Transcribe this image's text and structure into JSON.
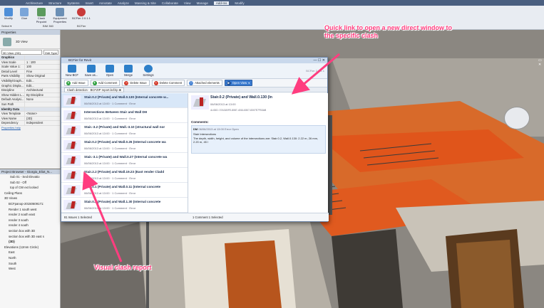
{
  "ribbon": {
    "tabs": [
      "Architecture",
      "Structure",
      "Systems",
      "Insert",
      "Annotate",
      "Analyze",
      "Massing & Site",
      "Collaborate",
      "View",
      "Manage",
      "Add-Ins",
      "Modify"
    ],
    "active_tab": "Add-Ins",
    "buttons": [
      {
        "label": "Modify"
      },
      {
        "label": "Glue"
      },
      {
        "label": "Clash Pinpoint"
      },
      {
        "label": "Equipment Properties"
      },
      {
        "label": "BCFier 2.0.1.1"
      }
    ],
    "groups": [
      "Select ▾",
      "BIM 360",
      "BCFier"
    ]
  },
  "properties": {
    "title": "Properties",
    "type_label": "3D View",
    "view_selector": "3D View: {3D}",
    "edit_type": "Edit Type",
    "rows": [
      {
        "k": "Graphics",
        "v": "",
        "section": true
      },
      {
        "k": "View Scale",
        "v": "1 : 100"
      },
      {
        "k": "Scale Value 1:",
        "v": "100"
      },
      {
        "k": "Detail Level",
        "v": "Fine"
      },
      {
        "k": "Parts Visibility",
        "v": "Show Original"
      },
      {
        "k": "Visibility/Graph...",
        "v": "Edit..."
      },
      {
        "k": "Graphic Displa...",
        "v": "Edit..."
      },
      {
        "k": "Discipline",
        "v": "Architectural"
      },
      {
        "k": "Show Hidden L...",
        "v": "By Discipline"
      },
      {
        "k": "Default Analysi...",
        "v": "None"
      },
      {
        "k": "Sun Path",
        "v": ""
      },
      {
        "k": "Identity Data",
        "v": "",
        "section": true
      },
      {
        "k": "View Template",
        "v": "<None>"
      },
      {
        "k": "View Name",
        "v": "{3D}"
      },
      {
        "k": "Dependency",
        "v": "Independent"
      }
    ],
    "help_link": "Properties help"
  },
  "browser": {
    "title": "Project Browser - Giorgio_Eliot_N...",
    "items": [
      "Sub 01 - Sed Elevatio",
      "Sub 02 - Off",
      "top of CW ext locked",
      "Ceiling Plans",
      "3D Views",
      "BCFpanop-20150609171:",
      "Render 1 south west",
      "render 2 south east",
      "render 3 south",
      "render 4 south",
      "section box with 3D",
      "section box with 3D east s",
      "{3D}",
      "Elevations (12mm Circle)",
      "East",
      "North",
      "South",
      "West"
    ]
  },
  "plugin": {
    "title": "BCFier for Revit",
    "right_label": "BCFier 2.0.1.1",
    "toolbar": [
      "New BCF",
      "Save as...",
      "Open",
      "Merge",
      "Settings"
    ],
    "actions": [
      "Add Issue",
      "Add Comment",
      "Delete Issue",
      "Delete Comment",
      "Attached elements",
      "Open View"
    ],
    "tab": "Clash detection - BCFZIP report.bcfzip ✖",
    "issues": [
      {
        "title": "Stair.0.2 (Private) and Wall.0.130 (Internal concrete w...",
        "meta": "06/06/2013 at 13:00  ·  1 Comment  ·  Error",
        "selected": true
      },
      {
        "title": "Intersections Between Stair and Wall  DH",
        "meta": "06/06/2013 at 13:00  ·  1 Comment  ·  Error"
      },
      {
        "title": "Stair.-3.2 (Private) and Wall.-3.10 (structural wall nor",
        "meta": "06/06/2013 at 13:00  ·  1 Comment  ·  Error"
      },
      {
        "title": "Stair.0.2 (Private) and Wall.0.26 (Internal concrete wa",
        "meta": "06/06/2013 at 13:00  ·  1 Comment  ·  Error"
      },
      {
        "title": "Stair.-3.1 (Private) and Wall.0.27 (Internal concrete wa",
        "meta": "06/06/2013 at 13:00  ·  1 Comment  ·  Error"
      },
      {
        "title": "Stair.2.2 (Private) and Wall.19.23 (East render Cladd",
        "meta": "06/06/2013 at 13:00  ·  1 Comment  ·  Error"
      },
      {
        "title": "Stair.0.1 (Private) and Wall.0.11 (Internal concrete",
        "meta": "06/06/2013 at 13:00  ·  1 Comment  ·  Error"
      },
      {
        "title": "Stair.0.2 (Private) and Wall.1.30 (Internal concrete",
        "meta": "06/06/2013 at 13:00  ·  1 Comment  ·  Error"
      }
    ],
    "list_status": "81 Issues   1 Selected",
    "detail": {
      "title": "Stair.0.2 (Private) and Wall.0.130 (In",
      "date": "06/06/2013 at 13:00",
      "guid": "4LIGID: 07A31BFE-8087-4016-8307-8307E7F53AB",
      "comments_label": "Comments:",
      "comment_author": "DM",
      "comment_meta": "06/06/2013 at 13:00   Error   Open",
      "comment_title": "Stair Intersections",
      "comment_body": "The depth, width, height, and volume of the intersections are: Stair.0.2, Wall.0.130: 2.22 m, 26 mm, 2.20 m, 45 l",
      "status": "1 Comment   1 Selected"
    }
  },
  "callouts": {
    "top": "Quick link to open a new direct window to the specific clash",
    "bottom": "Visual clash report"
  },
  "colors": {
    "callout": "#ff3d7f",
    "accent": "#3b7bd0",
    "floor": "#e0551b"
  }
}
